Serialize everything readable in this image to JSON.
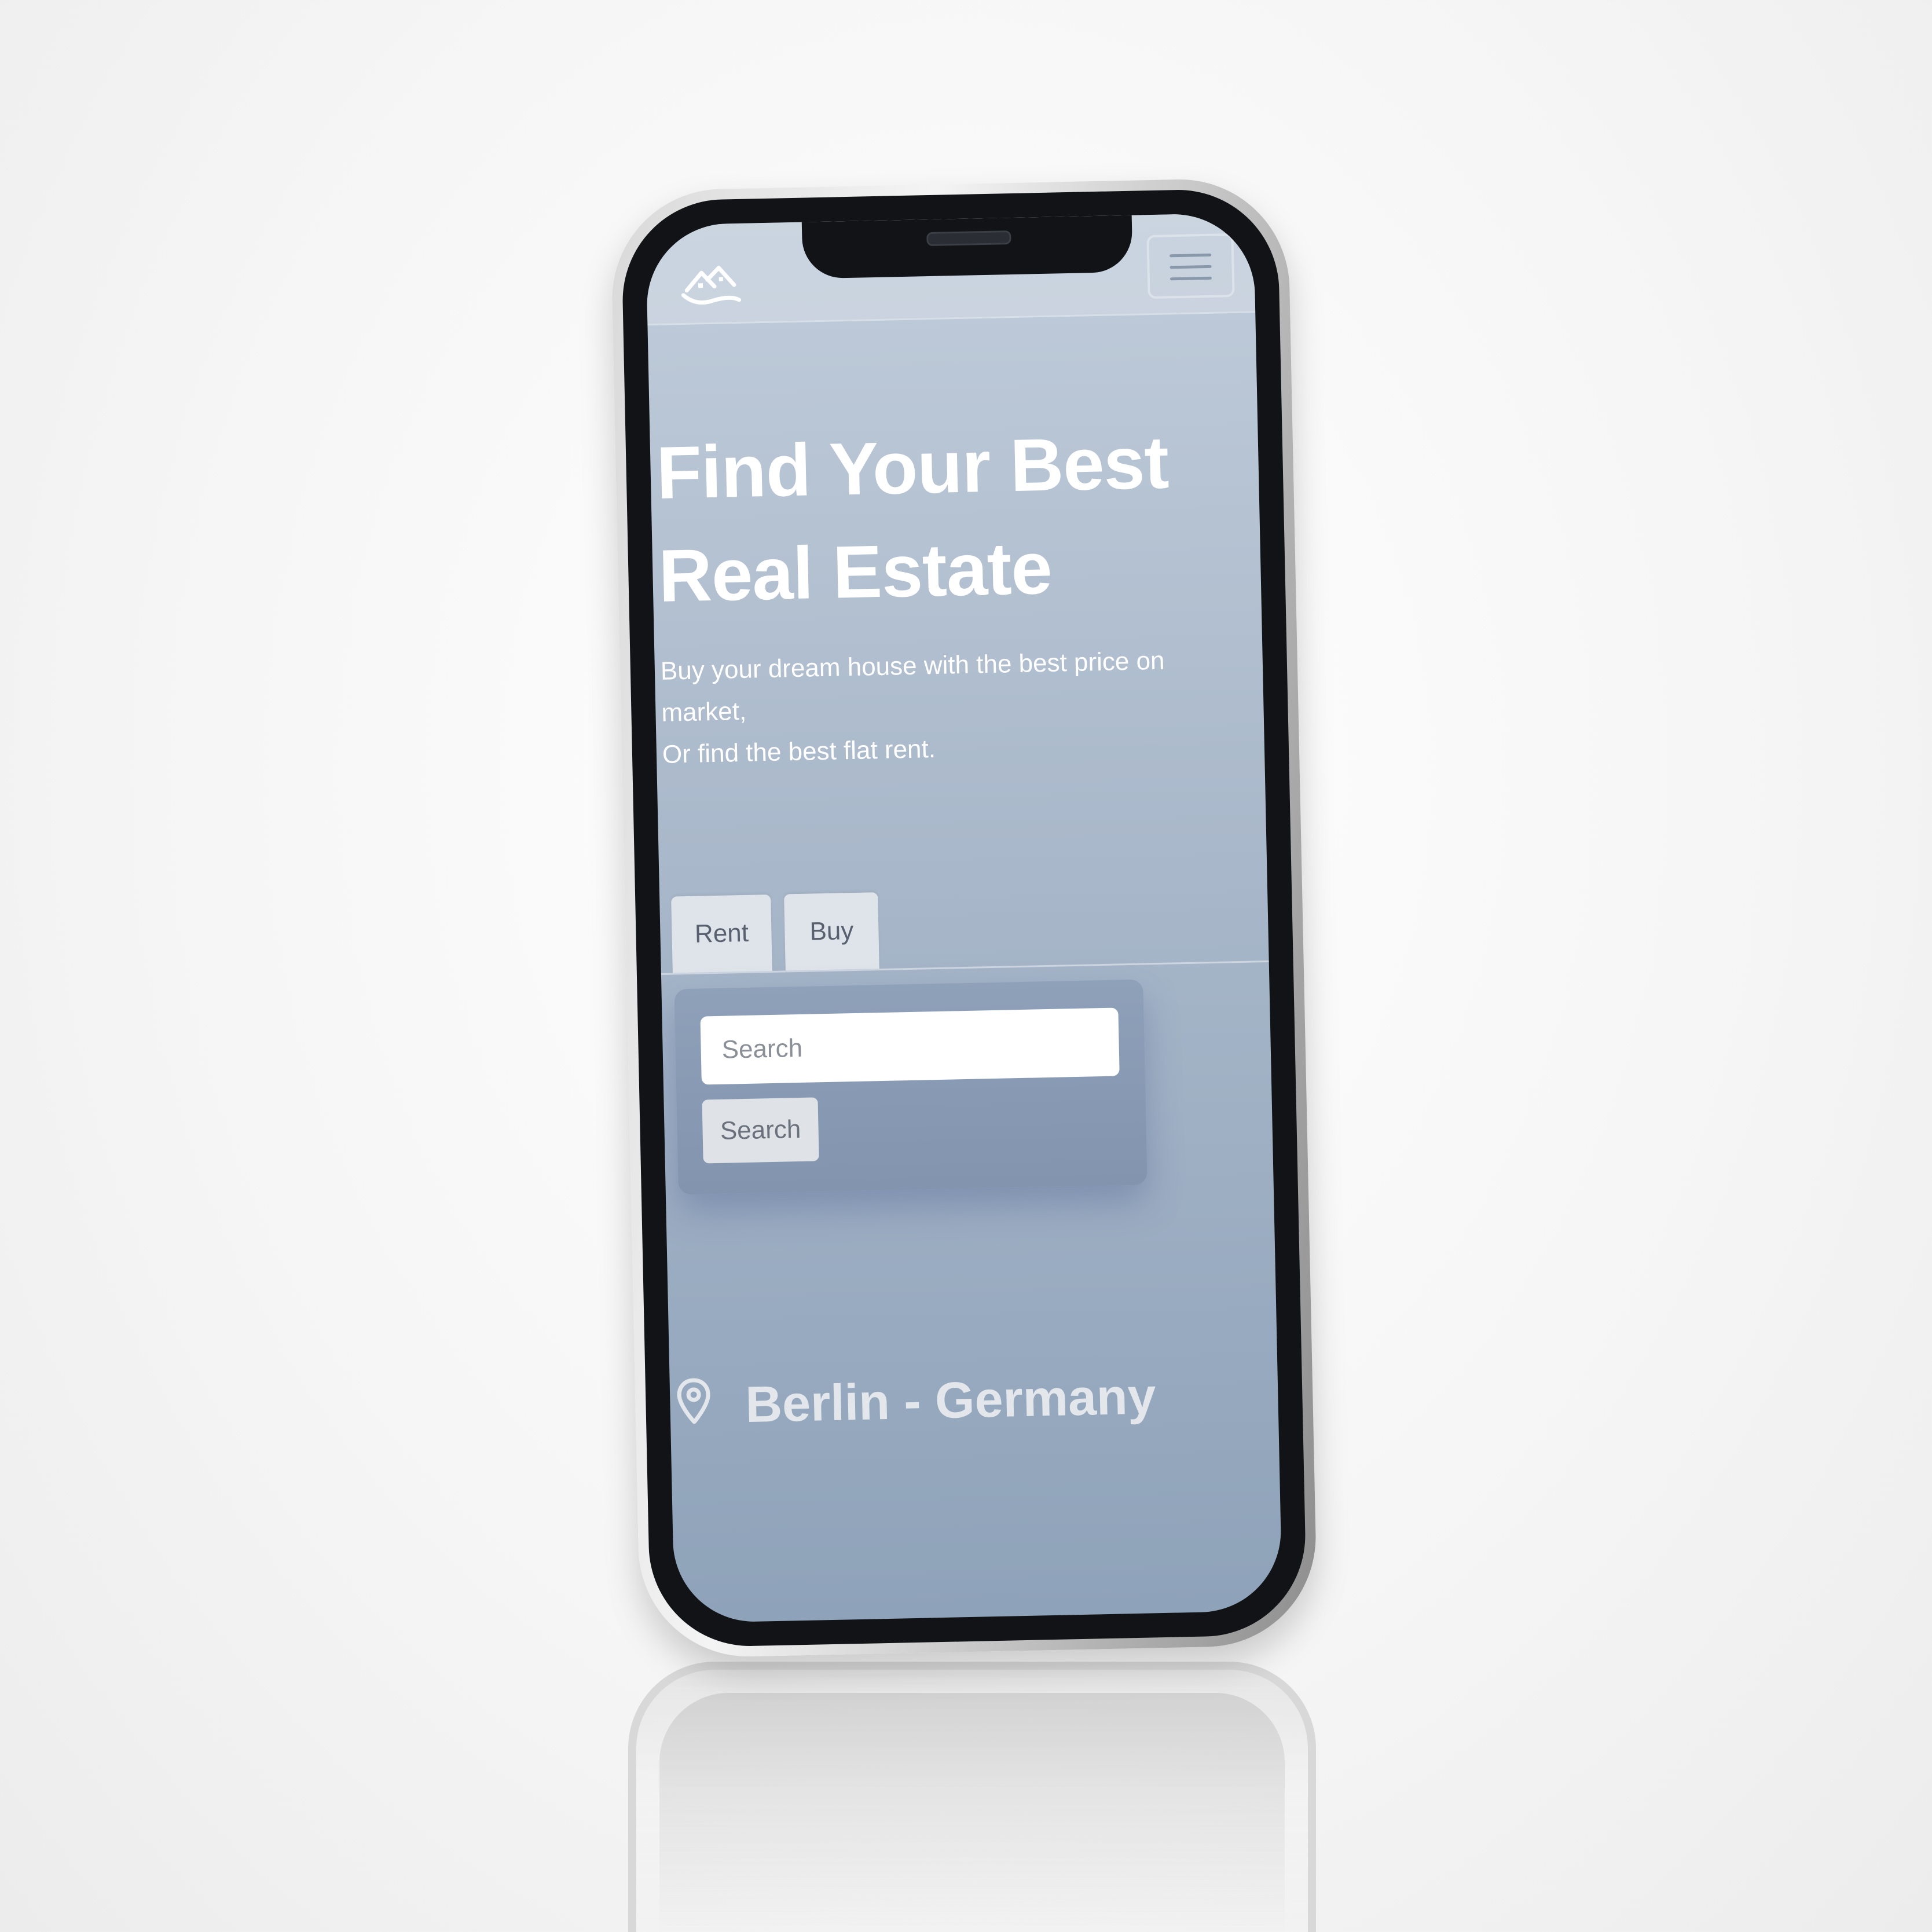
{
  "hero": {
    "title_line1": "Find Your Best",
    "title_line2": "Real Estate",
    "subtitle_line1": "Buy your dream house with the best price on",
    "subtitle_line2": "market,",
    "subtitle_line3": "Or find the best flat rent."
  },
  "tabs": {
    "rent": "Rent",
    "buy": "Buy"
  },
  "search": {
    "placeholder": "Search",
    "button_label": "Search"
  },
  "location": {
    "text": "Berlin - Germany"
  },
  "icons": {
    "logo": "house-logo-icon",
    "menu": "hamburger-menu-icon",
    "location": "map-pin-icon"
  },
  "colors": {
    "screen_top": "#c0ccda",
    "screen_bottom": "#8ea2b9",
    "card": "#8294ae",
    "hero_text": "#ffffff"
  }
}
